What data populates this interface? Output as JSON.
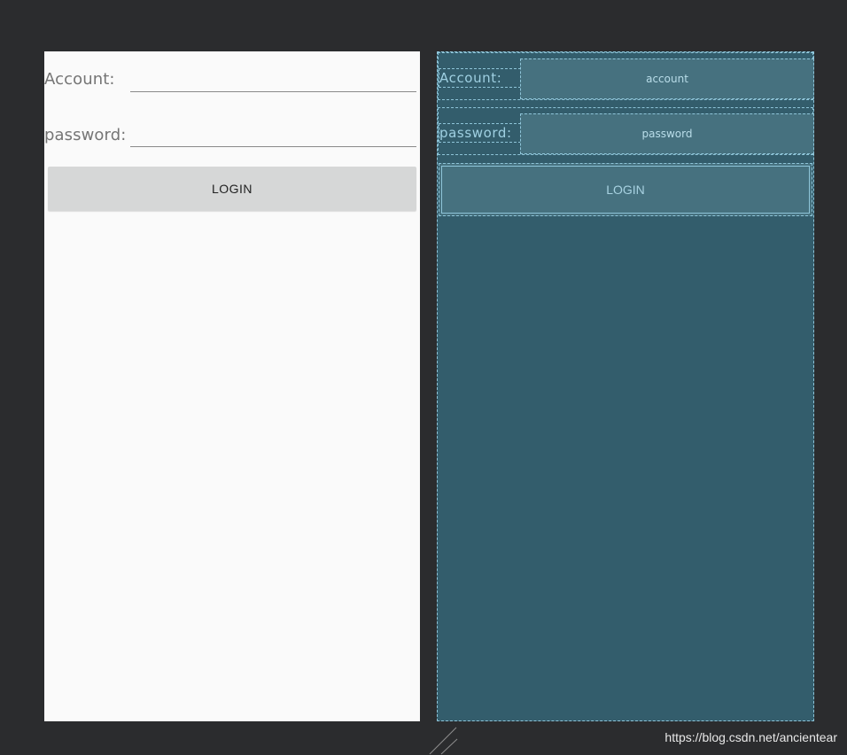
{
  "design": {
    "account_label": "Account:",
    "password_label": "password:",
    "login_button": "LOGIN"
  },
  "blueprint": {
    "account_label": "Account:",
    "account_hint": "account",
    "password_label": "password:",
    "password_hint": "password",
    "login_button": "LOGIN"
  },
  "watermark": "https://blog.csdn.net/ancientear",
  "colors": {
    "editor_background": "#2b2c2e",
    "design_background": "#fafafa",
    "button_background": "#d6d7d7",
    "blueprint_background": "#335d6c",
    "blueprint_outline": "#8ec4d8"
  }
}
